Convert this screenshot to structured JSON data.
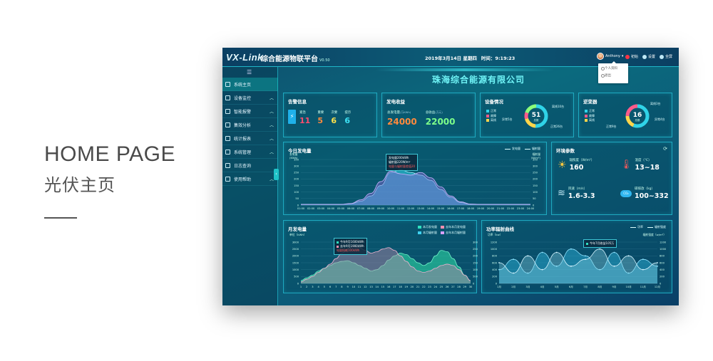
{
  "caption": {
    "title": "HOME PAGE",
    "subtitle": "光伏主页"
  },
  "topbar": {
    "logo": "VX-Link",
    "platform": "综合能源物联平台",
    "version": "V0.50",
    "date": "2019年3月14日 星期四",
    "time": "时间：9:19:23",
    "user": "Anthony",
    "actions": [
      "初始",
      "设置",
      "全屏"
    ]
  },
  "user_menu": [
    "个人资料",
    "退出"
  ],
  "sidebar": {
    "items": [
      {
        "label": "系统主页",
        "active": true
      },
      {
        "label": "设备监控"
      },
      {
        "label": "智能报警"
      },
      {
        "label": "集效分析"
      },
      {
        "label": "统计报表"
      },
      {
        "label": "系统管理"
      },
      {
        "label": "日志查询"
      },
      {
        "label": "使用帮助"
      }
    ]
  },
  "company": "珠海综合能源有限公司",
  "alarm": {
    "title": "告警信息",
    "items": [
      {
        "label": "紧急",
        "value": "11",
        "color": "#ff4d6d"
      },
      {
        "label": "重要",
        "value": "5",
        "color": "#ff8a3d"
      },
      {
        "label": "次要",
        "value": "6",
        "color": "#ffe14a"
      },
      {
        "label": "提示",
        "value": "6",
        "color": "#3de2f5"
      }
    ]
  },
  "generation": {
    "title": "发电收益",
    "items": [
      {
        "label": "总发电量",
        "unit": "(万KWh)",
        "value": "24000",
        "color": "#ff8a3d"
      },
      {
        "label": "总收益",
        "unit": "(万元)",
        "value": "22000",
        "color": "#7dff8a"
      }
    ]
  },
  "devices": {
    "title": "设备情况",
    "total": "51",
    "total_label": "总数",
    "legend": [
      "正常",
      "故障",
      "离线"
    ],
    "callouts": [
      "离线10台",
      "异常5台",
      "正常26台"
    ],
    "segments": [
      {
        "name": "正常",
        "value": 26,
        "color": "#2fd3e8"
      },
      {
        "name": "离线",
        "value": 10,
        "color": "#ffd54a"
      },
      {
        "name": "故障",
        "value": 5,
        "color": "#ff5a8a"
      },
      {
        "name": "other",
        "value": 10,
        "color": "#8bff7a"
      }
    ]
  },
  "inverter": {
    "title": "逆变器",
    "total": "16",
    "total_label": "总数",
    "legend": [
      "正常",
      "故障",
      "离线"
    ],
    "callouts": [
      "离线3台",
      "异常4台",
      "正常9台"
    ],
    "segments": [
      {
        "name": "正常",
        "value": 9,
        "color": "#2fd3e8"
      },
      {
        "name": "离线",
        "value": 3,
        "color": "#ffd54a"
      },
      {
        "name": "故障",
        "value": 4,
        "color": "#ff5a8a"
      }
    ]
  },
  "environment": {
    "title": "环境参数",
    "items": [
      {
        "label": "辐照度（W/m²）",
        "value": "160"
      },
      {
        "label": "温度（℃）",
        "value": "13~18"
      },
      {
        "label": "风速（m/s）",
        "value": "1.6-3.3"
      },
      {
        "label": "碳排放（kg）",
        "value": "100~332"
      }
    ]
  },
  "today_chart": {
    "title": "今日发电量",
    "legend": [
      "发电量",
      "辐射量"
    ],
    "y_left_label": "发电量",
    "y_left_unit": "(KWh)",
    "y_right_label": "辐射量",
    "y_right_unit": "(W/m²)",
    "tooltip": [
      "发电量200kWh",
      "辐射量220W/m²",
      "电量与辐射量差值20"
    ]
  },
  "month_chart": {
    "title": "月发电量",
    "legend": [
      "本月发电量",
      "去年本月发电量",
      "本月辐射量",
      "去年本月辐射量"
    ],
    "y_unit": "单位（kWh）",
    "tooltip": [
      "今年9月1600kWh",
      "去年9月1900kWh",
      "电量损耗100kWh"
    ]
  },
  "radiation_chart": {
    "title": "功率辐射曲线",
    "legend": [
      "功率",
      "辐射强度"
    ],
    "y_left_unit": "功率（kw）",
    "y_right_unit": "辐射强度（w/m²）",
    "tooltip": [
      "今年7月收益105万"
    ]
  },
  "chart_data": [
    {
      "type": "area",
      "title": "今日发电量",
      "x": [
        "01:00",
        "02:00",
        "03:00",
        "04:00",
        "05:00",
        "06:00",
        "07:00",
        "08:00",
        "09:00",
        "10:00",
        "11:00",
        "12:00",
        "13:00",
        "14:00",
        "15:00",
        "16:00",
        "17:00",
        "18:00",
        "19:00",
        "20:00",
        "21:00",
        "22:00",
        "23:00",
        "24:00"
      ],
      "series": [
        {
          "name": "发电量",
          "values": [
            5,
            5,
            5,
            5,
            5,
            10,
            30,
            70,
            150,
            250,
            270,
            250,
            230,
            190,
            120,
            60,
            20,
            5,
            5,
            5,
            5,
            5,
            5,
            5
          ]
        },
        {
          "name": "辐射量",
          "values": [
            5,
            5,
            5,
            5,
            5,
            12,
            40,
            90,
            180,
            260,
            240,
            230,
            250,
            210,
            140,
            70,
            25,
            8,
            5,
            5,
            5,
            5,
            5,
            5
          ]
        }
      ],
      "ylim": [
        0,
        350
      ],
      "yticks": [
        0,
        50,
        100,
        150,
        200,
        250,
        300,
        350
      ]
    },
    {
      "type": "area",
      "title": "月发电量",
      "x": [
        1,
        2,
        3,
        4,
        5,
        6,
        7,
        8,
        9,
        10,
        11,
        12,
        13,
        14,
        15,
        16,
        17,
        18,
        19,
        20,
        21,
        22,
        23,
        24,
        25,
        26,
        27,
        28,
        29,
        30
      ],
      "series": [
        {
          "name": "本月发电量",
          "values": [
            200,
            400,
            600,
            900,
            1100,
            1300,
            1500,
            1600,
            1650,
            1500,
            1300,
            1100,
            900,
            1000,
            1300,
            1700,
            2000,
            2200,
            2100,
            1800,
            1500,
            1300,
            1500,
            2000,
            2400,
            2300,
            1800,
            1200,
            600,
            200
          ]
        },
        {
          "name": "去年本月发电量",
          "values": [
            100,
            300,
            500,
            800,
            1100,
            1400,
            1800,
            2200,
            2500,
            2700,
            2600,
            2400,
            2200,
            2300,
            2500,
            2600,
            2400,
            2000,
            1600,
            1200,
            900,
            800,
            900,
            1100,
            1300,
            1400,
            1300,
            1000,
            600,
            200
          ]
        }
      ],
      "ylim": [
        0,
        3000
      ],
      "yticks": [
        0,
        500,
        1000,
        1500,
        2000,
        2500,
        3000
      ]
    },
    {
      "type": "area",
      "title": "功率辐射曲线",
      "x": [
        "1月",
        "2月",
        "3月",
        "4月",
        "5月",
        "6月",
        "7月",
        "8月",
        "9月",
        "10月",
        "11月",
        "12月"
      ],
      "series": [
        {
          "name": "功率",
          "values": [
            400,
            700,
            300,
            900,
            500,
            1000,
            800,
            400,
            900,
            300,
            700,
            500
          ]
        },
        {
          "name": "辐射强度",
          "values": [
            600,
            300,
            800,
            400,
            900,
            500,
            700,
            1000,
            500,
            800,
            400,
            600
          ]
        }
      ],
      "ylim": [
        0,
        1200
      ],
      "yticks": [
        0,
        200,
        400,
        600,
        800,
        1000,
        1200
      ]
    }
  ]
}
